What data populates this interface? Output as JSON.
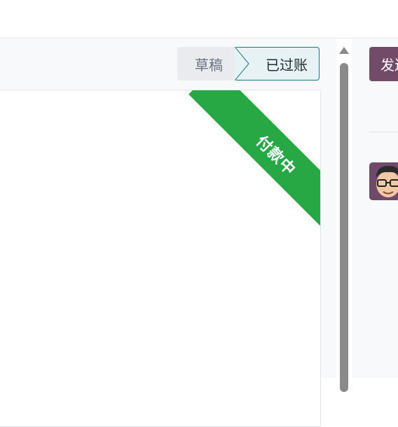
{
  "statusbar": {
    "stages": [
      {
        "label": "草稿",
        "active": false
      },
      {
        "label": "已过账",
        "active": true
      }
    ]
  },
  "sheet": {
    "ribbon_label": "付款中",
    "ribbon_color": "#28a745"
  },
  "chatter": {
    "send_button_label": "发送消息",
    "button_color": "#714b67"
  },
  "colors": {
    "active_stage_border": "#137b85",
    "scrollbar": "#8a8a8a"
  }
}
